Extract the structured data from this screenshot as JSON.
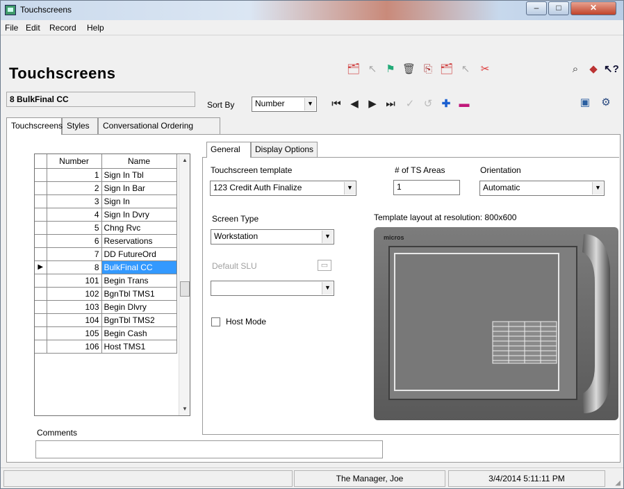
{
  "window": {
    "title": "Touchscreens",
    "minimize": "–",
    "maximize": "□",
    "close": "✕"
  },
  "menu": [
    "File",
    "Edit",
    "Record",
    "Help"
  ],
  "header": {
    "title": "Touchscreens",
    "record": "8 BulkFinal CC",
    "sort_by_label": "Sort By",
    "sort_by_value": "Number"
  },
  "toolbar_icons": [
    "search-binoculars-icon",
    "help-book-icon",
    "whats-this-help-icon",
    "monitor-icon",
    "settings-gear-icon"
  ],
  "tabs": [
    "Touchscreens",
    "Styles",
    "Conversational Ordering"
  ],
  "grid": {
    "columns": [
      "Number",
      "Name"
    ],
    "rows": [
      {
        "number": "1",
        "name": "Sign In Tbl"
      },
      {
        "number": "2",
        "name": "Sign In Bar"
      },
      {
        "number": "3",
        "name": "Sign In"
      },
      {
        "number": "4",
        "name": "Sign In Dvry"
      },
      {
        "number": "5",
        "name": "Chng Rvc"
      },
      {
        "number": "6",
        "name": "Reservations"
      },
      {
        "number": "7",
        "name": "DD FutureOrd"
      },
      {
        "number": "8",
        "name": "BulkFinal CC"
      },
      {
        "number": "101",
        "name": "Begin Trans"
      },
      {
        "number": "102",
        "name": "BgnTbl TMS1"
      },
      {
        "number": "103",
        "name": "Begin Dlvry"
      },
      {
        "number": "104",
        "name": "BgnTbl TMS2"
      },
      {
        "number": "105",
        "name": "Begin Cash"
      },
      {
        "number": "106",
        "name": "Host TMS1"
      }
    ],
    "selected_index": 7
  },
  "subtabs": [
    "General",
    "Display Options"
  ],
  "general": {
    "template_label": "Touchscreen template",
    "template_value": "123 Credit Auth Finalize",
    "areas_label": "# of TS Areas",
    "areas_value": "1",
    "orientation_label": "Orientation",
    "orientation_value": "Automatic",
    "screen_type_label": "Screen Type",
    "screen_type_value": "Workstation",
    "default_slu_label": "Default SLU",
    "default_slu_value": "",
    "host_mode_label": "Host Mode",
    "host_mode_checked": false,
    "layout_label": "Template layout at resolution: 800x600",
    "device_brand": "micros"
  },
  "comments": {
    "label": "Comments",
    "value": ""
  },
  "status": {
    "user": "The Manager, Joe",
    "datetime": "3/4/2014 5:11:11 PM"
  }
}
